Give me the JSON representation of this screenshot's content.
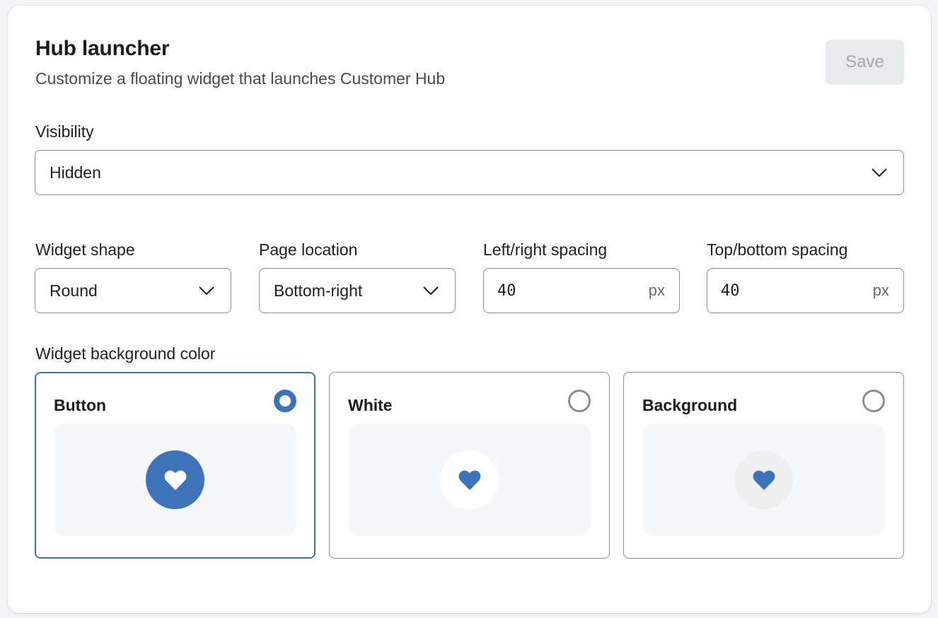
{
  "header": {
    "title": "Hub launcher",
    "subtitle": "Customize a floating widget that launches Customer Hub",
    "save_label": "Save"
  },
  "visibility": {
    "label": "Visibility",
    "value": "Hidden",
    "icon": "chevron-down-icon"
  },
  "widget_shape": {
    "label": "Widget shape",
    "value": "Round",
    "icon": "chevron-down-icon"
  },
  "page_location": {
    "label": "Page location",
    "value": "Bottom-right",
    "icon": "chevron-down-icon"
  },
  "left_right_spacing": {
    "label": "Left/right spacing",
    "value": "40",
    "suffix": "px"
  },
  "top_bottom_spacing": {
    "label": "Top/bottom spacing",
    "value": "40",
    "suffix": "px"
  },
  "background_color": {
    "label": "Widget background color",
    "selected": "Button",
    "options": [
      {
        "label": "Button",
        "selected": true,
        "circle_color": "#3d74b9",
        "heart_color": "#ffffff",
        "icon": "heart-icon"
      },
      {
        "label": "White",
        "selected": false,
        "circle_color": "#ffffff",
        "heart_color": "#3d74b9",
        "icon": "heart-icon"
      },
      {
        "label": "Background",
        "selected": false,
        "circle_color": "#f0f0f0",
        "heart_color": "#3d74b9",
        "icon": "heart-icon"
      }
    ]
  },
  "colors": {
    "accent": "#3d74b9",
    "preview_bg": "#f6f7f9",
    "border": "#8d8d8d",
    "save_disabled_bg": "#e9eaec",
    "save_disabled_text": "#a4a6aa"
  }
}
